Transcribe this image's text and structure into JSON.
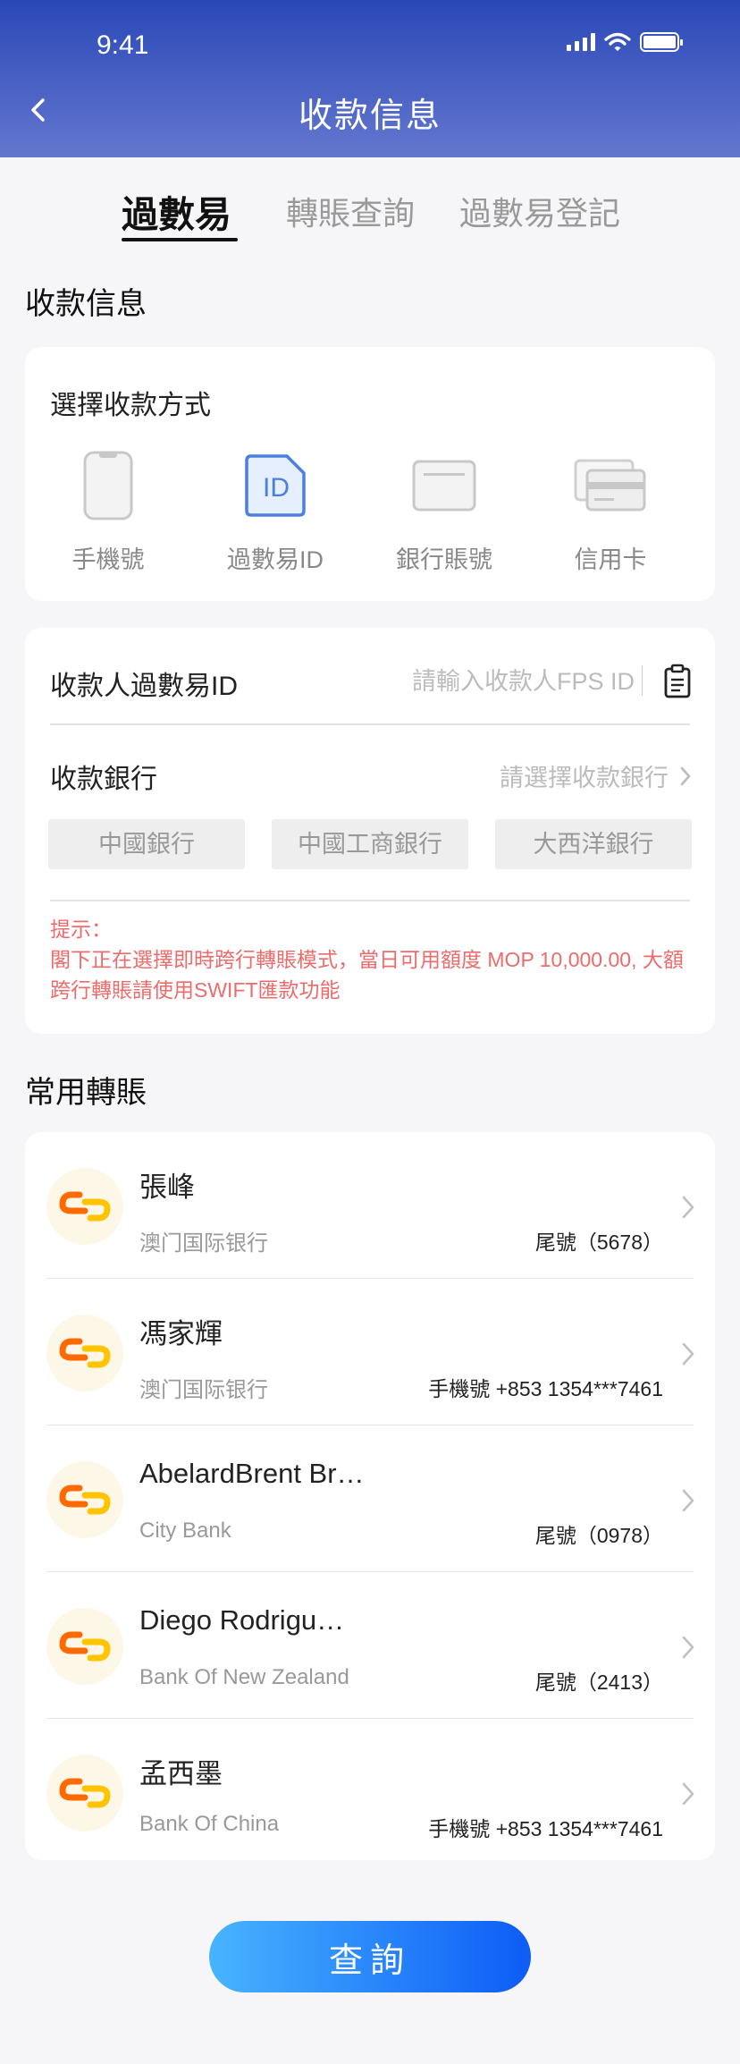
{
  "status_bar": {
    "time": "9:41"
  },
  "header": {
    "title": "收款信息"
  },
  "tabs": [
    {
      "label": "過數易",
      "active": true
    },
    {
      "label": "轉賬查詢",
      "active": false
    },
    {
      "label": "過數易登記",
      "active": false
    }
  ],
  "section_title": "收款信息",
  "method_card": {
    "title": "選擇收款方式",
    "methods": [
      {
        "label": "手機號",
        "icon": "phone-icon"
      },
      {
        "label": "過數易ID",
        "icon": "id-card-icon",
        "selected": true
      },
      {
        "label": "銀行賬號",
        "icon": "bank-card-icon"
      },
      {
        "label": "信用卡",
        "icon": "credit-card-icon"
      }
    ]
  },
  "form": {
    "fps_label": "收款人過數易ID",
    "fps_value": "",
    "fps_placeholder": "請輸入收款人FPS ID",
    "bank_label": "收款銀行",
    "bank_placeholder": "請選擇收款銀行",
    "bank_chips": [
      "中國銀行",
      "中國工商銀行",
      "大西洋銀行"
    ],
    "tip_title": "提示：",
    "tip_text": "閣下正在選擇即時跨行轉賬模式，當日可用額度 MOP 10,000.00, 大額跨行轉賬請使用SWIFT匯款功能"
  },
  "recent": {
    "title": "常用轉賬",
    "items": [
      {
        "name": "張峰",
        "bank": "澳门国际银行",
        "info": "尾號（5678）"
      },
      {
        "name": "馮家輝",
        "bank": "澳门国际银行",
        "info": "手機號 +853 1354***7461"
      },
      {
        "name": "AbelardBrent Br…",
        "bank": "City Bank",
        "info": "尾號（0978）"
      },
      {
        "name": "Diego Rodrigu…",
        "bank": "Bank Of  New Zealand",
        "info": "尾號（2413）"
      },
      {
        "name": "孟西墨",
        "bank": "Bank Of China",
        "info": "手機號 +853 1354***7461"
      }
    ]
  },
  "submit_label": "查詢",
  "colors": {
    "header_start": "#2a48b7",
    "header_end": "#6477cf",
    "accent": "#0d5cf6",
    "tip": "#ef6b6b"
  }
}
